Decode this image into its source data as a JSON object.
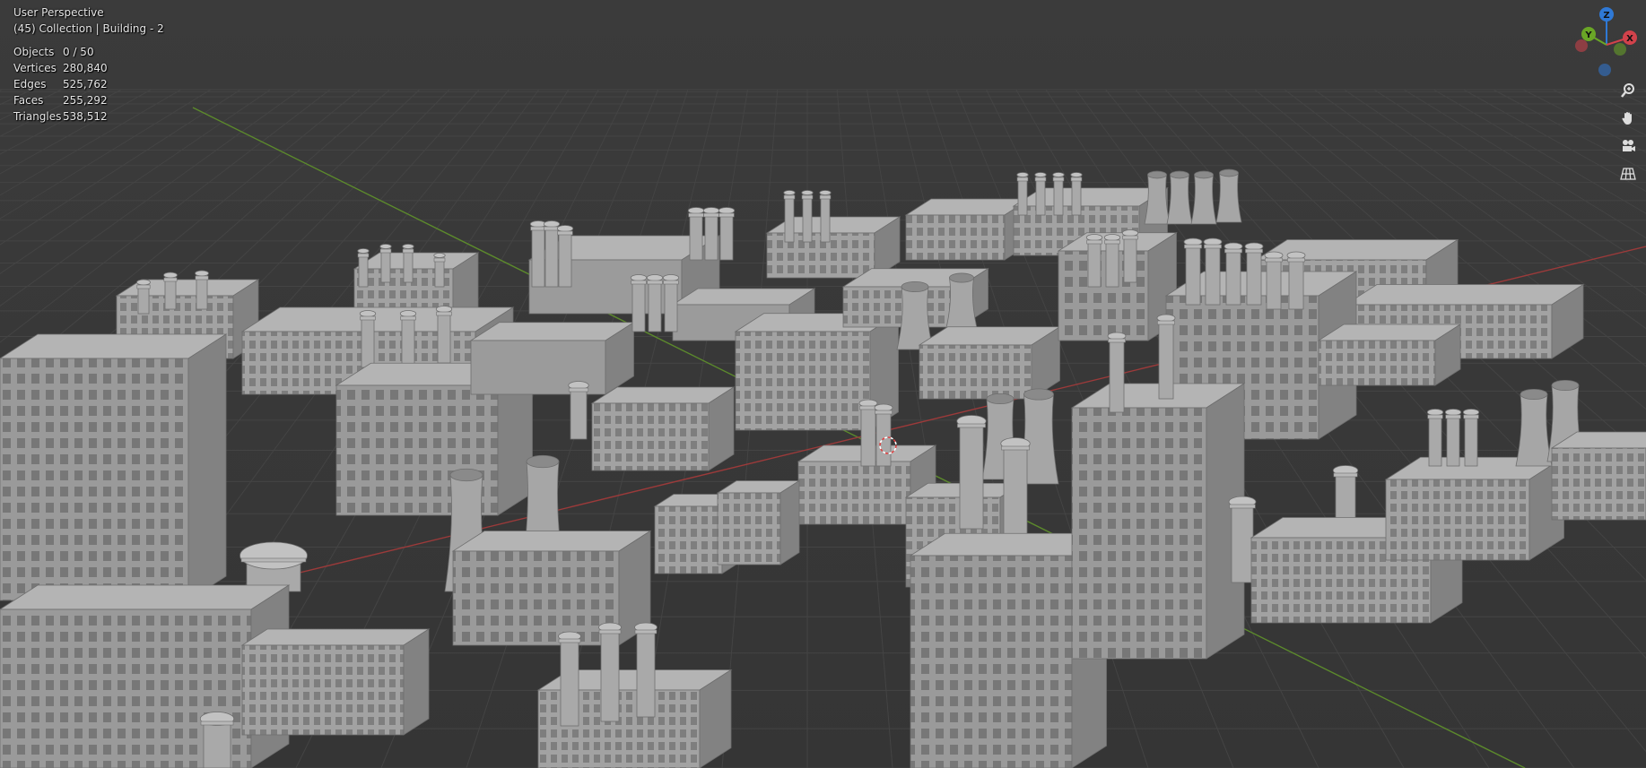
{
  "viewport": {
    "mode": "User Perspective",
    "collection": "(45) Collection | Building - 2",
    "background": "#3a3a3a",
    "grid_color": "#444444",
    "x_axis_color": "#9b3a3a",
    "y_axis_color": "#5c8a2c",
    "model_color": "#9d9d9d"
  },
  "stats": [
    {
      "label": "Objects",
      "value": "0 / 50"
    },
    {
      "label": "Vertices",
      "value": "280,840"
    },
    {
      "label": "Edges",
      "value": "525,762"
    },
    {
      "label": "Faces",
      "value": "255,292"
    },
    {
      "label": "Triangles",
      "value": "538,512"
    }
  ],
  "gizmo": {
    "z_label": "Z",
    "y_label": "Y",
    "x_label": "X",
    "z_color": "#2f79d6",
    "y_color": "#6aa626",
    "x_color": "#d2424b"
  },
  "nav_tools": [
    {
      "name": "zoom-icon"
    },
    {
      "name": "pan-hand-icon"
    },
    {
      "name": "camera-icon"
    },
    {
      "name": "grid-ortho-icon"
    }
  ]
}
